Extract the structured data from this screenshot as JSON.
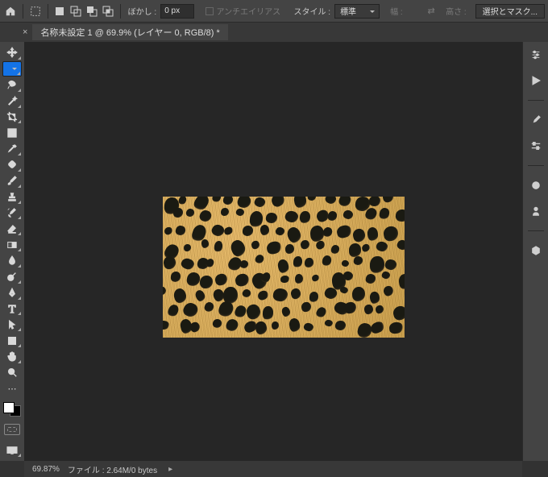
{
  "toolbar": {
    "feather_label": "ぼかし :",
    "feather_value": "0 px",
    "antialias_label": "アンチエイリアス",
    "style_label": "スタイル :",
    "style_value": "標準",
    "width_label": "幅 :",
    "height_label": "高さ :",
    "mask_button": "選択とマスク..."
  },
  "tab": {
    "title": "名称未設定 1 @ 69.9% (レイヤー 0, RGB/8) *"
  },
  "status": {
    "zoom": "69.87%",
    "file_label": "ファイル :",
    "file_size": "2.64M/0 bytes"
  },
  "tools": [
    "move",
    "marquee",
    "lasso",
    "wand",
    "crop",
    "frame",
    "eyedropper",
    "heal",
    "brush",
    "stamp",
    "history",
    "eraser",
    "gradient",
    "blur",
    "dodge",
    "pen",
    "type",
    "path",
    "rect",
    "hand",
    "zoom",
    "more"
  ],
  "right": [
    "properties",
    "play",
    "brush-settings",
    "adjustments",
    "threed",
    "character",
    "cube"
  ]
}
